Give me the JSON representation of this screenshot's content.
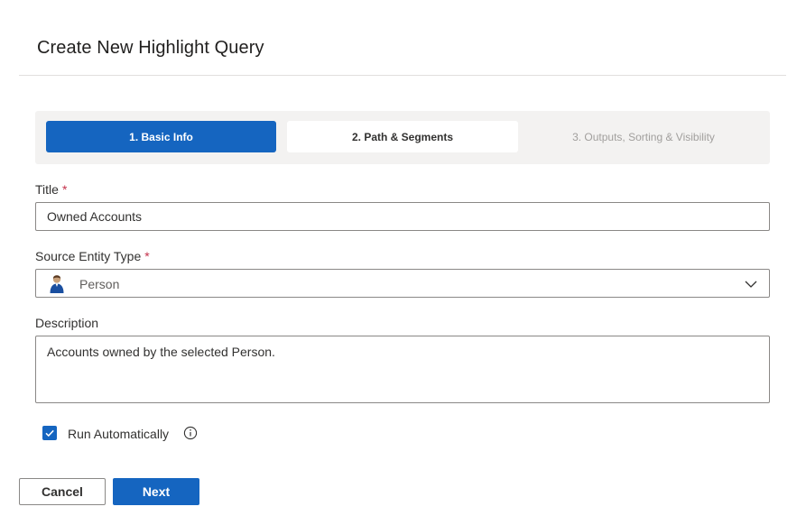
{
  "dialog": {
    "title": "Create New Highlight Query"
  },
  "steps": [
    {
      "label": "1. Basic Info",
      "state": "active"
    },
    {
      "label": "2. Path & Segments",
      "state": "available"
    },
    {
      "label": "3. Outputs, Sorting & Visibility",
      "state": "disabled"
    }
  ],
  "form": {
    "title_label": "Title",
    "title_value": "Owned Accounts",
    "source_label": "Source Entity Type",
    "source_value": "Person",
    "source_icon": "person-icon",
    "description_label": "Description",
    "description_value": "Accounts owned by the selected Person.",
    "required_marker": "*",
    "run_auto_label": "Run Automatically",
    "run_auto_checked": true
  },
  "buttons": {
    "cancel": "Cancel",
    "next": "Next"
  },
  "colors": {
    "accent": "#1565c0",
    "required": "#c4314b"
  }
}
